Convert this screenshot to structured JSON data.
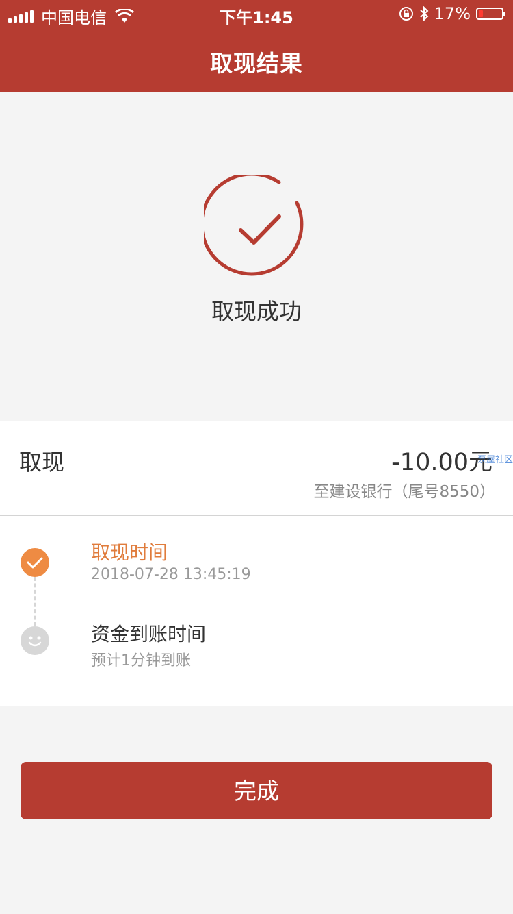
{
  "status_bar": {
    "carrier": "中国电信",
    "time": "下午1:45",
    "battery": "17%"
  },
  "header": {
    "title": "取现结果"
  },
  "result": {
    "text": "取现成功"
  },
  "transaction": {
    "label": "取现",
    "amount": "-10.00元",
    "destination": "至建设银行（尾号8550）",
    "watermark": "泵屋社区"
  },
  "timeline": {
    "items": [
      {
        "title": "取现时间",
        "detail": "2018-07-28 13:45:19"
      },
      {
        "title": "资金到账时间",
        "detail": "预计1分钟到账"
      }
    ]
  },
  "actions": {
    "done_label": "完成"
  },
  "colors": {
    "brand": "#b63c31",
    "accent_orange": "#ee8b43",
    "pending_gray": "#d7d7d7",
    "background": "#f4f4f4"
  },
  "icons": [
    "signal-icon",
    "wifi-icon",
    "orientation-lock-icon",
    "bluetooth-icon",
    "battery-icon",
    "success-check-icon",
    "check-icon",
    "smiley-icon"
  ]
}
